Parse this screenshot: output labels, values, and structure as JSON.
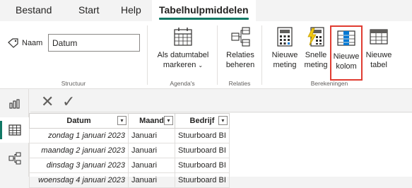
{
  "tabs": [
    "Bestand",
    "Start",
    "Help",
    "Tabelhulpmiddelen"
  ],
  "ribbon": {
    "structure": {
      "name_label": "Naam",
      "name_value": "Datum",
      "group_label": "Structuur"
    },
    "calendars": {
      "mark_line1": "Als datumtabel",
      "mark_line2": "markeren",
      "group_label": "Agenda's"
    },
    "relations": {
      "manage_line1": "Relaties",
      "manage_line2": "beheren",
      "group_label": "Relaties"
    },
    "calculations": {
      "new_measure_line1": "Nieuwe",
      "new_measure_line2": "meting",
      "quick_measure_line1": "Snelle",
      "quick_measure_line2": "meting",
      "new_column_line1": "Nieuwe",
      "new_column_line2": "kolom",
      "new_table_line1": "Nieuwe",
      "new_table_line2": "tabel",
      "group_label": "Berekeningen"
    }
  },
  "formula_bar": {
    "cancel": "✕",
    "commit": "✓"
  },
  "table": {
    "columns": [
      "Datum",
      "Maand",
      "Bedrijf"
    ],
    "rows": [
      [
        "zondag 1 januari 2023",
        "Januari",
        "Stuurboard BI"
      ],
      [
        "maandag 2 januari 2023",
        "Januari",
        "Stuurboard BI"
      ],
      [
        "dinsdag 3 januari 2023",
        "Januari",
        "Stuurboard BI"
      ],
      [
        "woensdag 4 januari 2023",
        "Januari",
        "Stuurboard BI"
      ]
    ]
  },
  "colors": {
    "accent": "#117865",
    "highlight": "#e03c31"
  }
}
